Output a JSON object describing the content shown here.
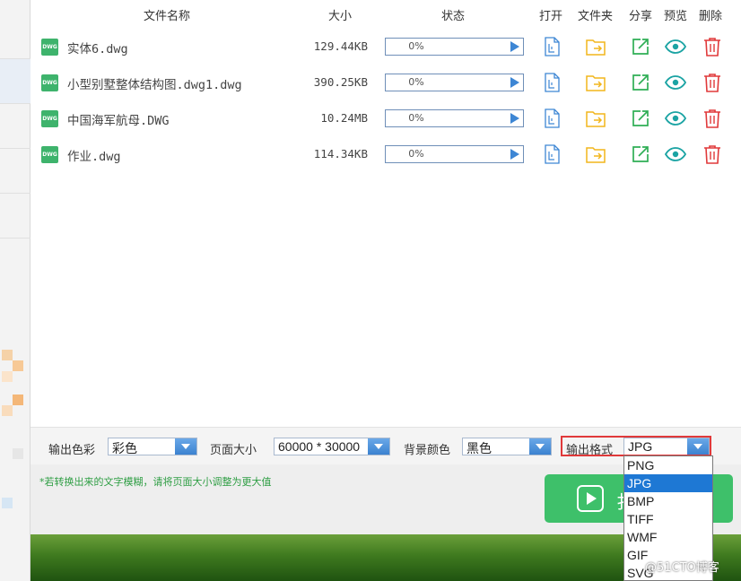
{
  "header": {
    "name": "文件名称",
    "size": "大小",
    "status": "状态",
    "open": "打开",
    "folder": "文件夹",
    "share": "分享",
    "preview": "预览",
    "delete": "删除"
  },
  "files": [
    {
      "icon_text": "DWG",
      "name": "实体6.dwg",
      "size": "129.44KB",
      "progress": "0%"
    },
    {
      "icon_text": "DWG",
      "name": "小型别墅整体结构图.dwg1.dwg",
      "size": "390.25KB",
      "progress": "0%"
    },
    {
      "icon_text": "DWG",
      "name": "中国海军航母.DWG",
      "size": "10.24MB",
      "progress": "0%"
    },
    {
      "icon_text": "DWG",
      "name": "作业.dwg",
      "size": "114.34KB",
      "progress": "0%"
    }
  ],
  "options": {
    "color_label": "输出色彩",
    "color_value": "彩色",
    "page_size_label": "页面大小",
    "page_size_value": "60000 * 30000",
    "bg_label": "背景颜色",
    "bg_value": "黑色",
    "format_label": "输出格式",
    "format_value": "JPG"
  },
  "hint": "*若转换出来的文字模糊，请将页面大小调整为更大值",
  "convert_button_partial": "扌",
  "format_options": [
    "PNG",
    "JPG",
    "BMP",
    "TIFF",
    "WMF",
    "GIF",
    "SVG"
  ],
  "selected_format_index": 1,
  "watermark": "@51CTO博客",
  "colors": {
    "accent_green": "#3ec06a",
    "accent_blue": "#1e78d4",
    "highlight_red": "#e0393a",
    "folder_yellow": "#f2b51b",
    "delete_red": "#e0393a",
    "preview_teal": "#1aa3a3"
  },
  "icons": [
    "file-open-icon",
    "folder-icon",
    "share-icon",
    "eye-icon",
    "trash-icon"
  ]
}
